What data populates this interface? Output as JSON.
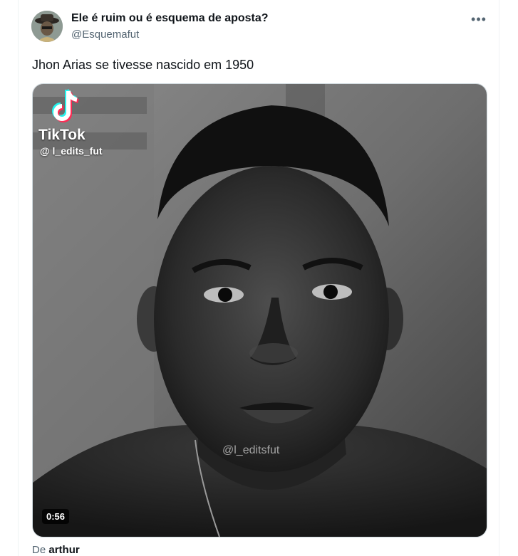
{
  "post": {
    "author_name": "Ele é ruim ou é esquema de aposta?",
    "author_handle": "@Esquemafut",
    "more_icon": "more-horizontal-icon",
    "text": "Jhon Arias se tivesse nascido em 1950"
  },
  "media": {
    "type": "video",
    "tiktok_wordmark": "TikTok",
    "tiktok_user": "@ l_edits_fut",
    "watermark": "@l_editsfut",
    "duration": "0:56"
  },
  "attribution": {
    "prefix": "De",
    "name": "arthur"
  }
}
